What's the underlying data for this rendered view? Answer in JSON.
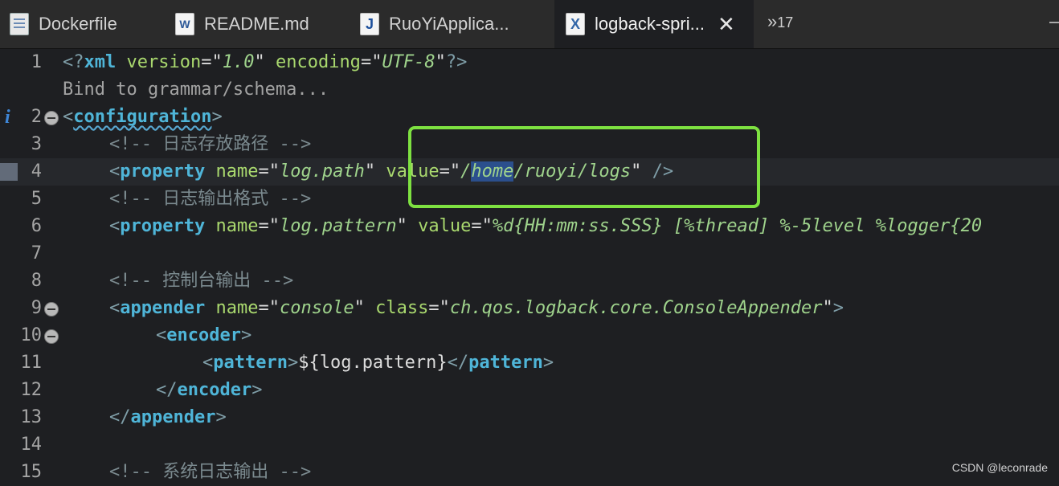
{
  "tabs": [
    {
      "label": "Dockerfile",
      "icon": "dockerfile-icon"
    },
    {
      "label": "README.md",
      "icon": "word-document-icon",
      "glyph": "W"
    },
    {
      "label": "RuoYiApplica...",
      "icon": "java-file-icon",
      "glyph": "J"
    },
    {
      "label": "logback-spri...",
      "icon": "xml-file-icon",
      "glyph": "X",
      "active": true
    }
  ],
  "tab_close": "✕",
  "overflow": {
    "glyph": "»",
    "count": "17"
  },
  "editor": {
    "line_numbers": [
      "1",
      "2",
      "3",
      "4",
      "5",
      "6",
      "7",
      "8",
      "9",
      "10",
      "11",
      "12",
      "13",
      "14",
      "15"
    ],
    "info_marker": "i",
    "lines": {
      "l1": {
        "open": "<?",
        "tag": "xml",
        "attr1": "version",
        "eq": "=",
        "q": "\"",
        "val1": "1.0",
        "attr2": "encoding",
        "val2": "UTF-8",
        "close": "?>"
      },
      "hint": "Bind to grammar/schema...",
      "l2": {
        "open": "<",
        "tag": "configuration",
        "close": ">"
      },
      "l3": {
        "comment": "<!-- 日志存放路径 -->"
      },
      "l4": {
        "open": "<",
        "tag": "property",
        "attr1": "name",
        "val1": "log.path",
        "attr2": "value",
        "val2a": "/",
        "val2b": "home",
        "val2c": "/ruoyi/logs",
        "close": "/>"
      },
      "l5": {
        "comment": "<!-- 日志输出格式 -->"
      },
      "l6": {
        "open": "<",
        "tag": "property",
        "attr1": "name",
        "val1": "log.pattern",
        "attr2": "value",
        "val2": "%d{HH:mm:ss.SSS} [%thread] %-5level %logger{20"
      },
      "l8": {
        "comment": "<!-- 控制台输出 -->"
      },
      "l9": {
        "open": "<",
        "tag": "appender",
        "attr1": "name",
        "val1": "console",
        "attr2": "class",
        "val2": "ch.qos.logback.core.ConsoleAppender",
        "close": ">"
      },
      "l10": {
        "open": "<",
        "tag": "encoder",
        "close": ">"
      },
      "l11": {
        "open": "<",
        "tag": "pattern",
        "close": ">",
        "text": "${log.pattern}",
        "end_open": "</"
      },
      "l12": {
        "open": "</",
        "tag": "encoder",
        "close": ">"
      },
      "l13": {
        "open": "</",
        "tag": "appender",
        "close": ">"
      },
      "l15": {
        "comment": "<!-- 系统日志输出 -->"
      }
    }
  },
  "watermark": "CSDN @leconrade"
}
